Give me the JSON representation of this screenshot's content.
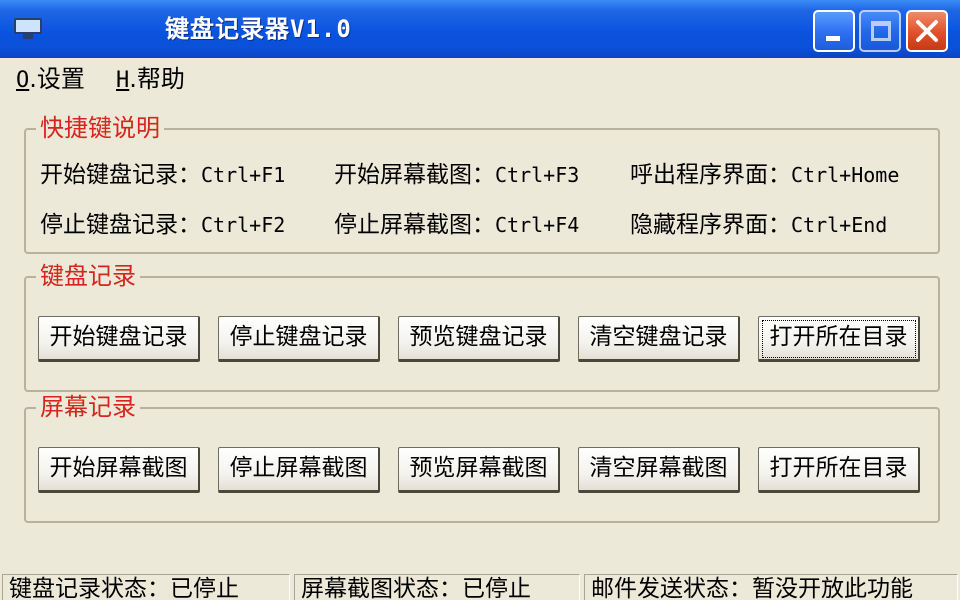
{
  "window": {
    "title": "键盘记录器V1.0"
  },
  "menu": {
    "settings": {
      "accel": "O",
      "label": ".设置"
    },
    "help": {
      "accel": "H",
      "label": ".帮助"
    }
  },
  "shortcuts": {
    "title": "快捷键说明",
    "items": [
      {
        "label": "开始键盘记录：",
        "key": "Ctrl+F1"
      },
      {
        "label": "开始屏幕截图：",
        "key": "Ctrl+F3"
      },
      {
        "label": "呼出程序界面：",
        "key": "Ctrl+Home"
      },
      {
        "label": "停止键盘记录：",
        "key": "Ctrl+F2"
      },
      {
        "label": "停止屏幕截图：",
        "key": "Ctrl+F4"
      },
      {
        "label": "隐藏程序界面：",
        "key": "Ctrl+End"
      }
    ]
  },
  "keyboard_group": {
    "title": "键盘记录",
    "buttons": [
      "开始键盘记录",
      "停止键盘记录",
      "预览键盘记录",
      "清空键盘记录",
      "打开所在目录"
    ]
  },
  "screen_group": {
    "title": "屏幕记录",
    "buttons": [
      "开始屏幕截图",
      "停止屏幕截图",
      "预览屏幕截图",
      "清空屏幕截图",
      "打开所在目录"
    ]
  },
  "status": {
    "keyboard": "键盘记录状态：已停止",
    "screen": "屏幕截图状态：已停止",
    "mail": "邮件发送状态：暂没开放此功能"
  },
  "colors": {
    "titlebar": "#0a54e0",
    "group_title": "#d5251c",
    "window_bg": "#ece9d8"
  }
}
